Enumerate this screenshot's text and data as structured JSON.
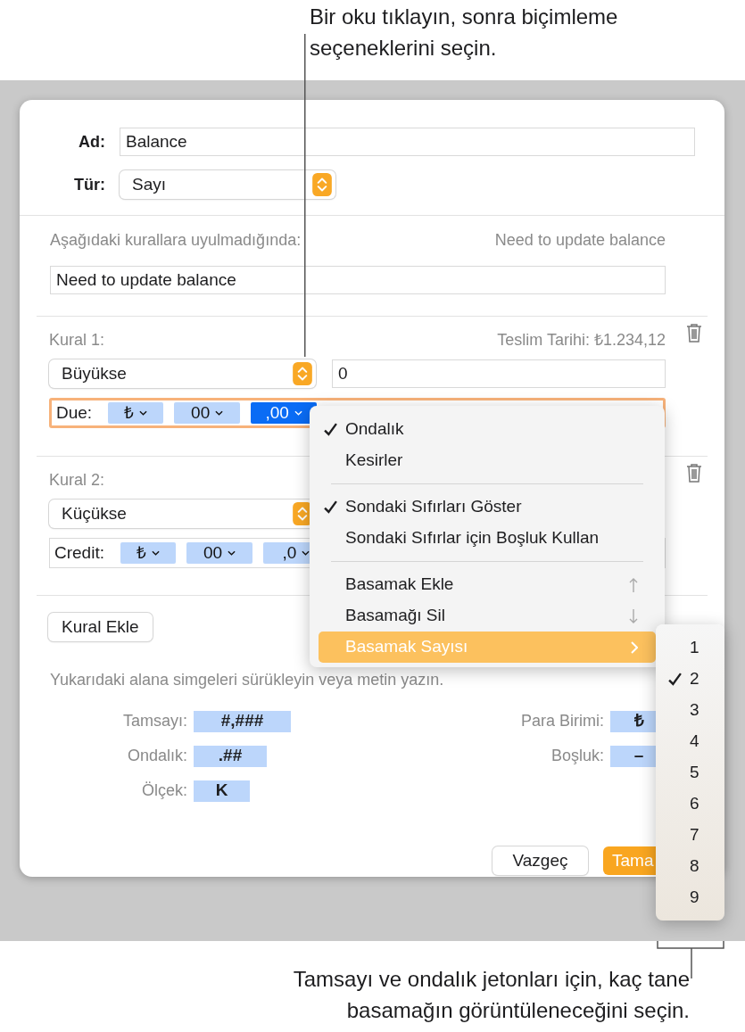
{
  "callouts": [
    {
      "kind": "top",
      "text": "Bir oku tıklayın, sonra biçimleme seçeneklerini seçin."
    },
    {
      "kind": "bottom",
      "text": "Tamsayı ve ondalık jetonları için, kaç tane basamağın görüntüleneceğini seçin."
    }
  ],
  "dialog": {
    "name": {
      "label": "Ad:",
      "value": "Balance"
    },
    "type": {
      "label": "Tür:",
      "value": "Sayı"
    },
    "failure": {
      "label": "Aşağıdaki kurallara uyulmadığında:",
      "preview": "Need to update balance",
      "value": "Need to update balance"
    },
    "rules": [
      {
        "label": "Kural 1:",
        "preview": "Teslim Tarihi: ₺1.234,12",
        "condition": "Büyükse",
        "value": "0",
        "format_label": "Due:",
        "focused": true,
        "tokens": [
          {
            "text": "₺",
            "selected": false
          },
          {
            "text": "00",
            "selected": false
          },
          {
            "text": ",00",
            "selected": true
          }
        ]
      },
      {
        "label": "Kural 2:",
        "condition": "Küçükse",
        "format_label": "Credit:",
        "focused": false,
        "tokens": [
          {
            "text": "₺",
            "selected": false
          },
          {
            "text": "00",
            "selected": false
          },
          {
            "text": ",0",
            "selected": false
          }
        ]
      }
    ],
    "add_rule_button": "Kural Ekle",
    "hint": "Yukarıdaki alana simgeleri sürükleyin veya metin yazın.",
    "symbols": [
      {
        "label": "Tamsayı:",
        "token": "#,###"
      },
      {
        "label": "Para Birimi:",
        "token": "₺"
      },
      {
        "label": "Ondalık:",
        "token": ".##"
      },
      {
        "label": "Boşluk:",
        "token": "–"
      },
      {
        "label": "Ölçek:",
        "token": "K"
      }
    ],
    "buttons": [
      {
        "label": "Vazgeç",
        "kind": "secondary"
      },
      {
        "label": "Tama",
        "kind": "primary"
      }
    ]
  },
  "menu": {
    "items": [
      {
        "kind": "item",
        "label": "Ondalık",
        "checked": true,
        "selected": false
      },
      {
        "kind": "item",
        "label": "Kesirler",
        "checked": false,
        "selected": false
      },
      {
        "kind": "separator"
      },
      {
        "kind": "item",
        "label": "Sondaki Sıfırları Göster",
        "checked": true,
        "selected": false
      },
      {
        "kind": "item",
        "label": "Sondaki Sıfırlar için Boşluk Kullan",
        "checked": false,
        "selected": false
      },
      {
        "kind": "separator"
      },
      {
        "kind": "increment",
        "label": "Basamak Ekle",
        "checked": false,
        "selected": false
      },
      {
        "kind": "decrement",
        "label": "Basamağı Sil",
        "checked": false,
        "selected": false
      },
      {
        "kind": "submenu",
        "label": "Basamak Sayısı",
        "checked": false,
        "selected": true
      }
    ]
  },
  "submenu": {
    "items": [
      {
        "label": "1",
        "checked": false
      },
      {
        "label": "2",
        "checked": true
      },
      {
        "label": "3",
        "checked": false
      },
      {
        "label": "4",
        "checked": false
      },
      {
        "label": "5",
        "checked": false
      },
      {
        "label": "6",
        "checked": false
      },
      {
        "label": "7",
        "checked": false
      },
      {
        "label": "8",
        "checked": false
      },
      {
        "label": "9",
        "checked": false
      }
    ]
  }
}
